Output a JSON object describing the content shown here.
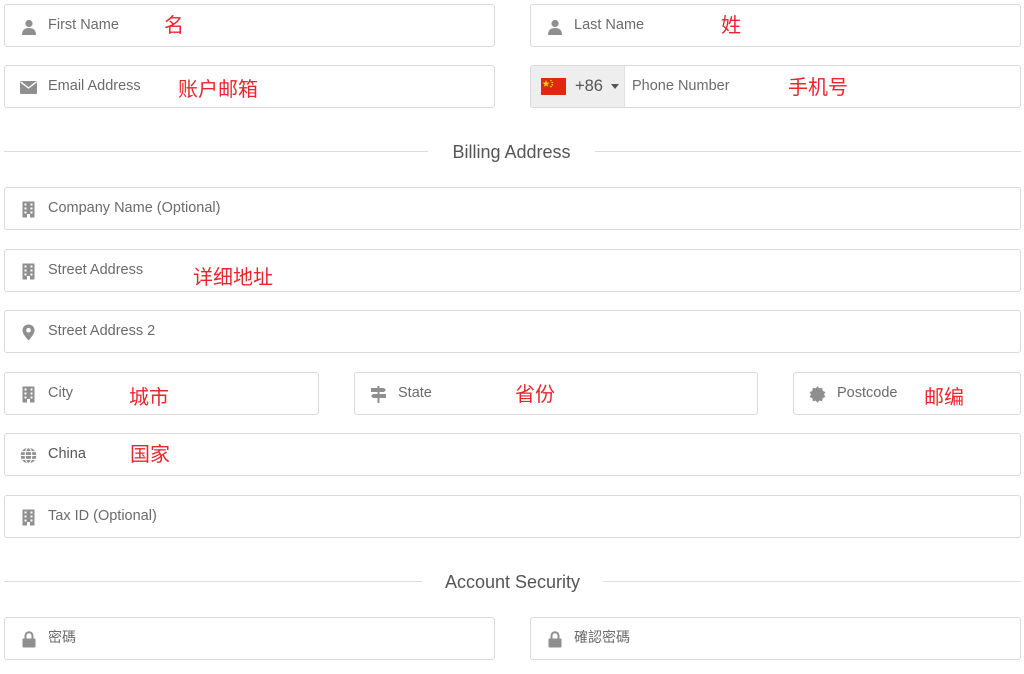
{
  "colors": {
    "note": "#e8242d",
    "border": "#d9d9d9",
    "icon": "#8f8f8f",
    "placeholder": "#6b6b6b"
  },
  "personal": {
    "first_name": {
      "placeholder": "First Name",
      "note": "名",
      "icon": "user-icon"
    },
    "last_name": {
      "placeholder": "Last Name",
      "note": "姓",
      "icon": "user-icon"
    },
    "email": {
      "placeholder": "Email Address",
      "note": "账户邮箱",
      "icon": "envelope-icon"
    },
    "phone": {
      "country_code": "+86",
      "flag": "china-flag-icon",
      "placeholder": "Phone Number",
      "note": "手机号"
    }
  },
  "billing": {
    "title": "Billing Address",
    "company": {
      "placeholder": "Company Name (Optional)",
      "icon": "building-icon"
    },
    "street": {
      "placeholder": "Street Address",
      "note": "详细地址",
      "icon": "building-icon"
    },
    "street2": {
      "placeholder": "Street Address 2",
      "icon": "map-pin-icon"
    },
    "city": {
      "placeholder": "City",
      "note": "城市",
      "icon": "building-icon"
    },
    "state": {
      "placeholder": "State",
      "note": "省份",
      "icon": "signpost-icon"
    },
    "postcode": {
      "placeholder": "Postcode",
      "note": "邮编",
      "icon": "certificate-icon"
    },
    "country": {
      "value": "China",
      "note": "国家",
      "icon": "globe-icon"
    },
    "tax": {
      "placeholder": "Tax ID (Optional)",
      "icon": "building-icon"
    }
  },
  "security": {
    "title": "Account Security",
    "password": {
      "placeholder": "密碼",
      "icon": "lock-icon"
    },
    "confirm": {
      "placeholder": "確認密碼",
      "icon": "lock-icon"
    }
  }
}
